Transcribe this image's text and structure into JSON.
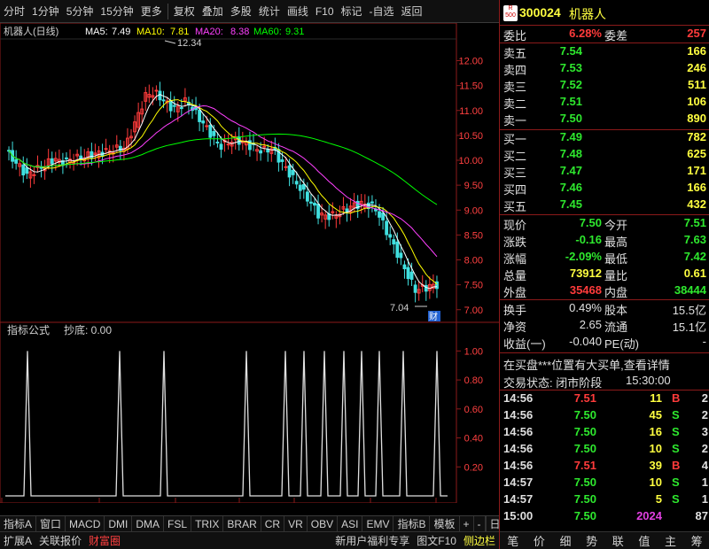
{
  "toolbar": {
    "items": [
      "分时",
      "1分钟",
      "5分钟",
      "15分钟",
      "更多",
      "复权",
      "叠加",
      "多股",
      "统计",
      "画线",
      "F10",
      "标记",
      "-自选",
      "返回"
    ]
  },
  "chart_header": {
    "title": "机器人(日线)",
    "ma5_label": "MA5:",
    "ma5_value": "7.49",
    "ma10_label": "MA10:",
    "ma10_value": "7.81",
    "ma20_label": "MA20:",
    "ma20_value": "8.38",
    "ma60_label": "MA60:",
    "ma60_value": "9.31",
    "colors": {
      "ma5": "#ffffff",
      "ma10": "#ffff00",
      "ma20": "#ff40ff",
      "ma60": "#00ff00"
    }
  },
  "chart_data": [
    {
      "type": "candlestick",
      "ylim": [
        6.8,
        12.4
      ],
      "y_ticks": [
        "12.00",
        "11.50",
        "11.00",
        "10.50",
        "10.00",
        "9.50",
        "9.00",
        "8.50",
        "8.00",
        "7.50",
        "7.00"
      ],
      "y_tick_values": [
        12.0,
        11.5,
        11.0,
        10.5,
        10.0,
        9.5,
        9.0,
        8.5,
        8.0,
        7.5,
        7.0
      ],
      "high_annotation": "12.34",
      "low_annotation": "7.04",
      "low_badge": "财",
      "x_labels": [
        "2021年",
        "12",
        "1",
        "2",
        "3",
        "4",
        "5"
      ]
    },
    {
      "type": "bar",
      "title": "指标公式",
      "subtitle": "抄底: 0.00",
      "ylim": [
        0,
        1.1
      ],
      "y_ticks": [
        "1.00",
        "0.80",
        "0.60",
        "0.40",
        "0.20"
      ],
      "y_tick_values": [
        1.0,
        0.8,
        0.6,
        0.4,
        0.2
      ]
    }
  ],
  "quote": {
    "code": "300024",
    "name": "机器人",
    "badge_top": "R",
    "badge_bottom": "500",
    "weibi_label": "委比",
    "weibi_value": "6.28%",
    "weicha_label": "委差",
    "weicha_value": "257",
    "asks": [
      {
        "label": "卖五",
        "price": "7.54",
        "vol": "166"
      },
      {
        "label": "卖四",
        "price": "7.53",
        "vol": "246"
      },
      {
        "label": "卖三",
        "price": "7.52",
        "vol": "511"
      },
      {
        "label": "卖二",
        "price": "7.51",
        "vol": "106"
      },
      {
        "label": "卖一",
        "price": "7.50",
        "vol": "890"
      }
    ],
    "bids": [
      {
        "label": "买一",
        "price": "7.49",
        "vol": "782"
      },
      {
        "label": "买二",
        "price": "7.48",
        "vol": "625"
      },
      {
        "label": "买三",
        "price": "7.47",
        "vol": "171"
      },
      {
        "label": "买四",
        "price": "7.46",
        "vol": "166"
      },
      {
        "label": "买五",
        "price": "7.45",
        "vol": "432"
      }
    ],
    "stats": [
      {
        "l1": "现价",
        "v1": "7.50",
        "c1": "green",
        "l2": "今开",
        "v2": "7.51",
        "c2": "green"
      },
      {
        "l1": "涨跌",
        "v1": "-0.16",
        "c1": "green",
        "l2": "最高",
        "v2": "7.63",
        "c2": "green"
      },
      {
        "l1": "涨幅",
        "v1": "-2.09%",
        "c1": "green",
        "l2": "最低",
        "v2": "7.42",
        "c2": "green"
      },
      {
        "l1": "总量",
        "v1": "73912",
        "c1": "yellow",
        "l2": "量比",
        "v2": "0.61",
        "c2": "yellow"
      },
      {
        "l1": "外盘",
        "v1": "35468",
        "c1": "red",
        "l2": "内盘",
        "v2": "38444",
        "c2": "green"
      }
    ],
    "fund": [
      {
        "l1": "换手",
        "v1": "0.49%",
        "l2": "股本",
        "v2": "15.5亿"
      },
      {
        "l1": "净资",
        "v1": "2.65",
        "l2": "流通",
        "v2": "15.1亿"
      },
      {
        "l1": "收益(一)",
        "v1": "-0.040",
        "l2": "PE(动)",
        "v2": "-"
      }
    ],
    "notice": "在买盘***位置有大买单,查看详情",
    "status_label": "交易状态: 闭市阶段",
    "status_time": "15:30:00",
    "ticks": [
      {
        "t": "14:56",
        "p": "7.51",
        "v": "11",
        "d": "B",
        "n": "2",
        "pc": "red",
        "dc": "red"
      },
      {
        "t": "14:56",
        "p": "7.50",
        "v": "45",
        "d": "S",
        "n": "2",
        "pc": "green",
        "dc": "green"
      },
      {
        "t": "14:56",
        "p": "7.50",
        "v": "16",
        "d": "S",
        "n": "3",
        "pc": "green",
        "dc": "green"
      },
      {
        "t": "14:56",
        "p": "7.50",
        "v": "10",
        "d": "S",
        "n": "2",
        "pc": "green",
        "dc": "green"
      },
      {
        "t": "14:56",
        "p": "7.51",
        "v": "39",
        "d": "B",
        "n": "4",
        "pc": "red",
        "dc": "red"
      },
      {
        "t": "14:57",
        "p": "7.50",
        "v": "10",
        "d": "S",
        "n": "1",
        "pc": "green",
        "dc": "green"
      },
      {
        "t": "14:57",
        "p": "7.50",
        "v": "5",
        "d": "S",
        "n": "1",
        "pc": "green",
        "dc": "green"
      },
      {
        "t": "15:00",
        "p": "7.50",
        "v": "2024",
        "d": "",
        "n": "87",
        "pc": "green",
        "dc": "green"
      }
    ]
  },
  "bottom_tabs": [
    "指标A",
    "窗口",
    "MACD",
    "DMI",
    "DMA",
    "FSL",
    "TRIX",
    "BRAR",
    "CR",
    "VR",
    "OBV",
    "ASI",
    "EMV",
    "指标B",
    "模板",
    "+",
    "-"
  ],
  "period_label": "日线",
  "statusbar": {
    "left": [
      "扩展A",
      "关联报价",
      "财富圈"
    ],
    "right": [
      "新用户福利专享",
      "图文F10",
      "侧边栏"
    ]
  },
  "right_bottom": [
    "笔",
    "价",
    "细",
    "势",
    "联",
    "值",
    "主",
    "筹"
  ]
}
